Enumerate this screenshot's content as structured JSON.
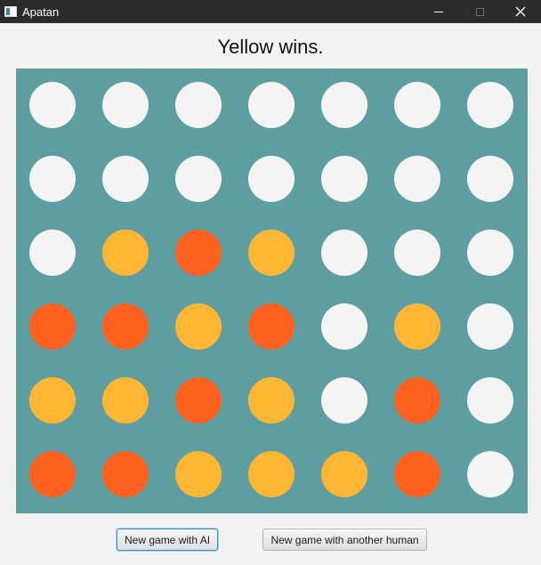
{
  "window": {
    "title": "Apatan",
    "controls": [
      "minimize-icon",
      "maximize-icon",
      "close-icon"
    ]
  },
  "status": {
    "text": "Yellow wins."
  },
  "board": {
    "rows": 6,
    "columns": 7,
    "colors": {
      "empty": "#f4f4f4",
      "yellow": "#ffb635",
      "red": "#fe6120",
      "board": "#5f9ea0"
    },
    "cells": [
      [
        "empty",
        "empty",
        "empty",
        "empty",
        "empty",
        "empty",
        "empty"
      ],
      [
        "empty",
        "empty",
        "empty",
        "empty",
        "empty",
        "empty",
        "empty"
      ],
      [
        "empty",
        "yellow",
        "red",
        "yellow",
        "empty",
        "empty",
        "empty"
      ],
      [
        "red",
        "red",
        "yellow",
        "red",
        "empty",
        "yellow",
        "empty"
      ],
      [
        "yellow",
        "yellow",
        "red",
        "yellow",
        "empty",
        "red",
        "empty"
      ],
      [
        "red",
        "red",
        "yellow",
        "yellow",
        "yellow",
        "red",
        "empty"
      ]
    ]
  },
  "buttons": {
    "ai": "New game with AI",
    "human": "New game with another human"
  }
}
